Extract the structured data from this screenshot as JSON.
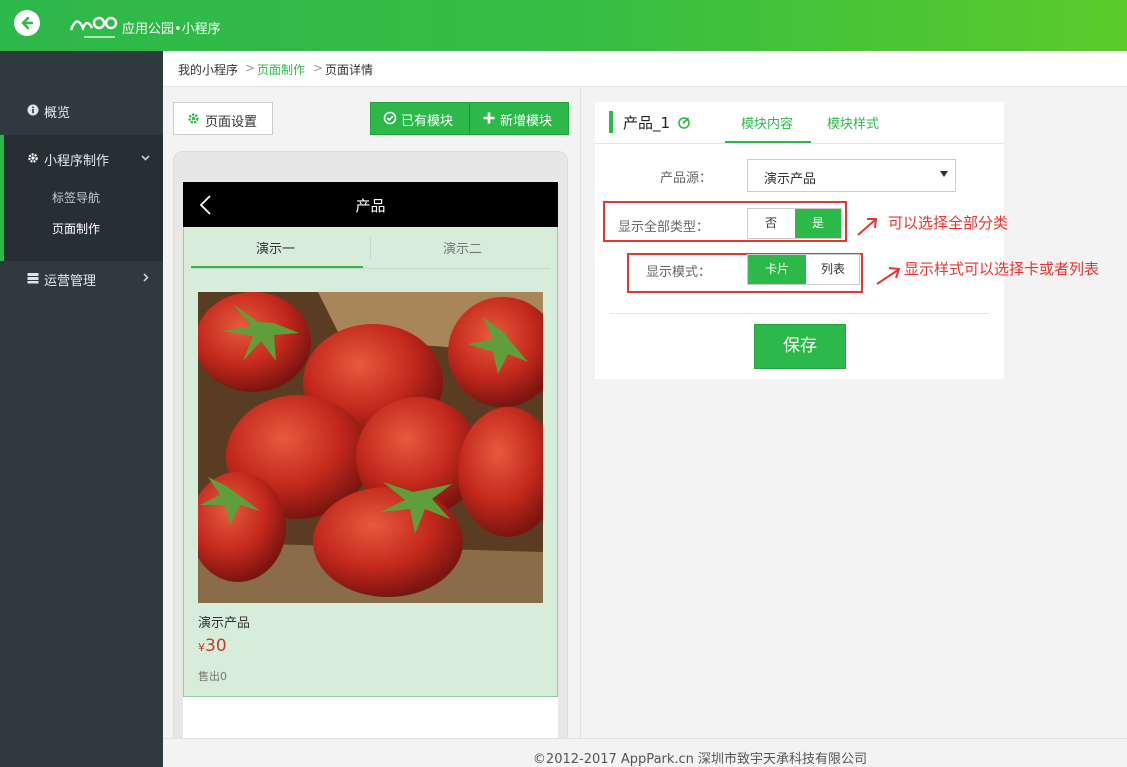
{
  "header": {
    "brand": "应用公园•小程序"
  },
  "sidebar": {
    "overview": "概览",
    "mini_program": "小程序制作",
    "sub_items": [
      "标签导航",
      "页面制作"
    ],
    "operations": "运营管理"
  },
  "breadcrumb": {
    "items": [
      "我的小程序",
      "页面制作",
      "页面详情"
    ]
  },
  "toolbar": {
    "page_settings": "页面设置",
    "existing_modules": "已有模块",
    "add_module": "新增模块"
  },
  "phone": {
    "title": "产品",
    "tabs": [
      "演示一",
      "演示二"
    ],
    "product": {
      "name": "演示产品",
      "currency": "¥",
      "price": "30",
      "sold": "售出0"
    }
  },
  "panel": {
    "title": "产品_1",
    "tabs": [
      "模块内容",
      "模块样式"
    ],
    "source_label": "产品源：",
    "source_value": "演示产品",
    "show_all_label": "显示全部类型：",
    "show_all_options": [
      "否",
      "是"
    ],
    "show_all_selected": "是",
    "mode_label": "显示模式：",
    "mode_options": [
      "卡片",
      "列表"
    ],
    "mode_selected": "卡片",
    "save": "保存"
  },
  "annotations": {
    "note1": "可以选择全部分类",
    "note2": "显示样式可以选择卡或者列表"
  },
  "footer": {
    "copyright": "©2012-2017 AppPark.cn 深圳市致宇天承科技有限公司"
  },
  "colors": {
    "brand_green": "#2db84a",
    "annotation_red": "#e8352f",
    "sidebar_bg": "#2f3a3e"
  }
}
